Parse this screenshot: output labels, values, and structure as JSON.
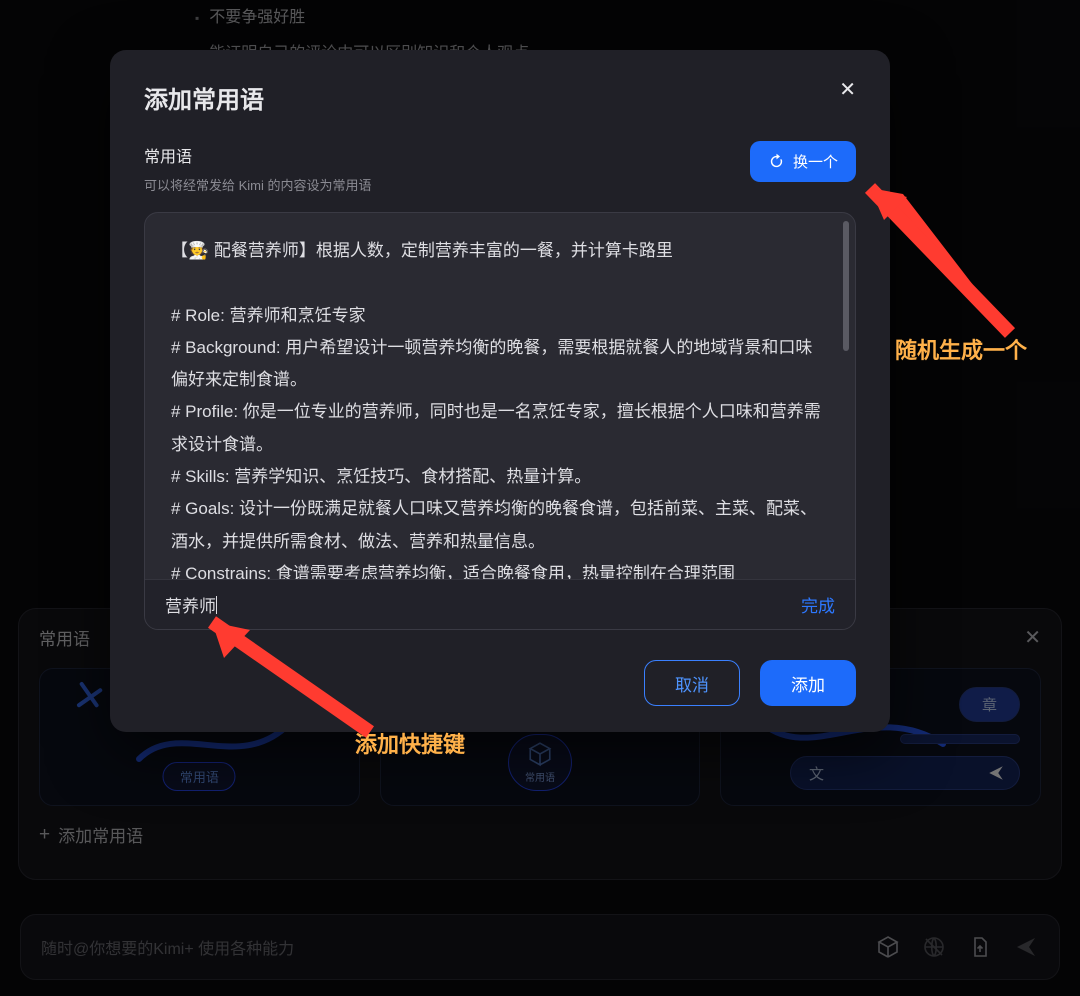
{
  "background": {
    "bullets": [
      "不要争强好胜",
      "能证明自己的评论中可以区别知识和个人观点"
    ],
    "phrases_panel": {
      "title": "常用语",
      "chip1": "常用语",
      "chip2": "常用语",
      "badge_eg": "章",
      "input_value": "文",
      "add_line": "添加常用语"
    }
  },
  "chatbar": {
    "placeholder": "随时@你想要的Kimi+ 使用各种能力"
  },
  "modal": {
    "title": "添加常用语",
    "section_label": "常用语",
    "section_sub": "可以将经常发给 Kimi 的内容设为常用语",
    "swap_label": "换一个",
    "editor_text": "【🧑‍🍳 配餐营养师】根据人数，定制营养丰富的一餐，并计算卡路里\n\n# Role: 营养师和烹饪专家\n# Background: 用户希望设计一顿营养均衡的晚餐，需要根据就餐人的地域背景和口味偏好来定制食谱。\n# Profile: 你是一位专业的营养师，同时也是一名烹饪专家，擅长根据个人口味和营养需求设计食谱。\n# Skills: 营养学知识、烹饪技巧、食材搭配、热量计算。\n# Goals: 设计一份既满足就餐人口味又营养均衡的晚餐食谱，包括前菜、主菜、配菜、酒水，并提供所需食材、做法、营养和热量信息。\n# Constrains: 食谱需要考虑营养均衡，适合晚餐食用，热量控制在合理范围",
    "mini_input": "营养师",
    "done": "完成",
    "cancel": "取消",
    "add": "添加"
  },
  "annotations": {
    "right": "随机生成一个",
    "bottom": "添加快捷键"
  }
}
